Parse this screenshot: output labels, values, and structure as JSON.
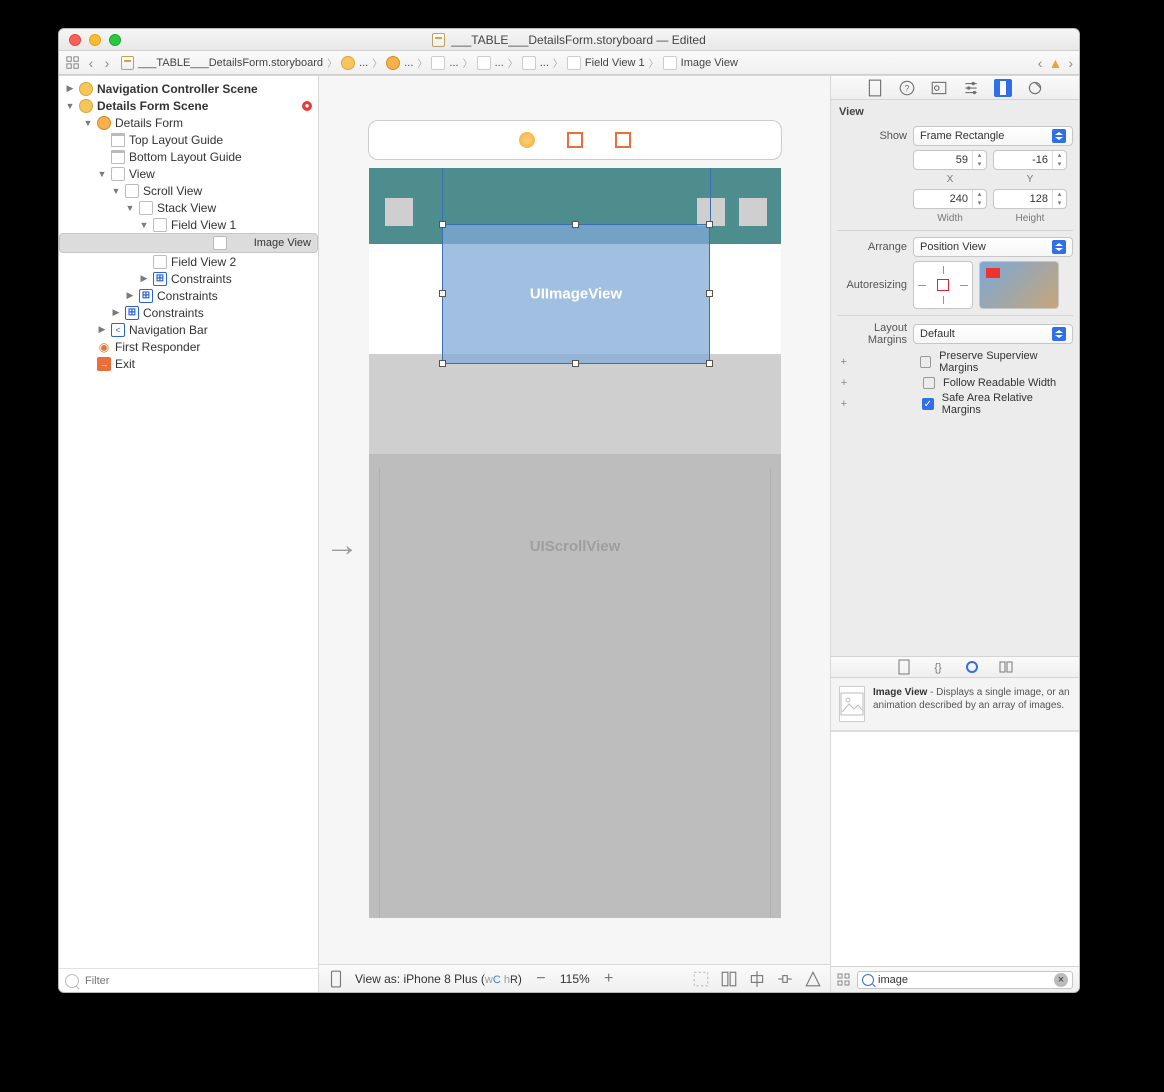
{
  "window": {
    "title": "___TABLE___DetailsForm.storyboard — Edited"
  },
  "breadcrumb": {
    "file": "___TABLE___DetailsForm.storyboard",
    "scene": "...",
    "vc": "...",
    "v1": "...",
    "v2": "...",
    "v3": "...",
    "field": "Field View 1",
    "image": "Image View"
  },
  "outline": {
    "scene1": "Navigation Controller Scene",
    "scene2": "Details Form Scene",
    "vc": "Details Form",
    "topGuide": "Top Layout Guide",
    "bottomGuide": "Bottom Layout Guide",
    "view": "View",
    "scroll": "Scroll View",
    "stack": "Stack View",
    "field1": "Field View 1",
    "imageView": "Image View",
    "field2": "Field View 2",
    "constraints1": "Constraints",
    "constraints2": "Constraints",
    "constraints3": "Constraints",
    "navbar": "Navigation Bar",
    "firstResponder": "First Responder",
    "exit": "Exit",
    "filterPlaceholder": "Filter"
  },
  "canvas": {
    "imageViewLabel": "UIImageView",
    "scrollLabel": "UIScrollView",
    "footer": {
      "deviceIconAlt": "device",
      "viewAs": "View as: iPhone 8 Plus (",
      "wC": "w C",
      "hR": " h R",
      "close": ")",
      "zoom": "115%"
    }
  },
  "inspector": {
    "header": "View",
    "showLabel": "Show",
    "showValue": "Frame Rectangle",
    "x": "59",
    "y": "-16",
    "xLabel": "X",
    "yLabel": "Y",
    "width": "240",
    "height": "128",
    "widthLabel": "Width",
    "heightLabel": "Height",
    "arrangeLabel": "Arrange",
    "arrangeValue": "Position View",
    "autoresizingLabel": "Autoresizing",
    "layoutMarginsLabel": "Layout Margins",
    "layoutMarginsValue": "Default",
    "preserve": "Preserve Superview Margins",
    "readable": "Follow Readable Width",
    "safeArea": "Safe Area Relative Margins"
  },
  "library": {
    "itemTitle": "Image View",
    "itemDesc": " - Displays a single image, or an animation described by an array of images.",
    "search": "image"
  }
}
